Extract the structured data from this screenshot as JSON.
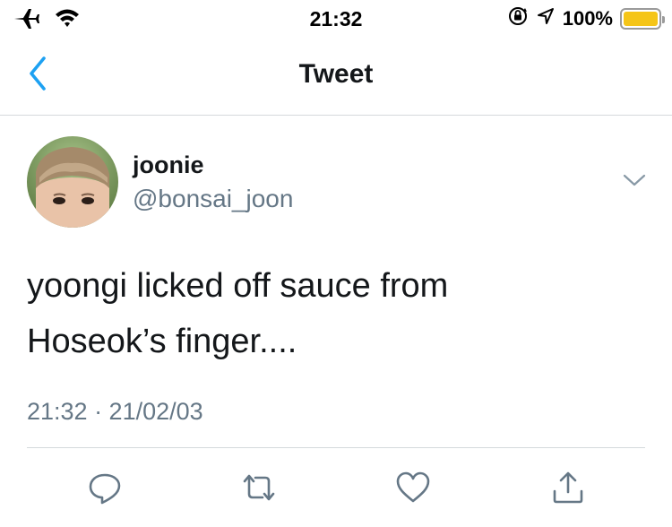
{
  "status_bar": {
    "time": "21:32",
    "battery_percent": "100%",
    "battery_level": 1.0,
    "icons": [
      "airplane-icon",
      "wifi-icon",
      "orientation-lock-icon",
      "location-arrow-icon",
      "battery-icon"
    ],
    "battery_color": "#f5c518"
  },
  "nav": {
    "title": "Tweet",
    "back_icon": "chevron-left-icon",
    "accent_color": "#1da1f2"
  },
  "tweet": {
    "author_name": "joonie",
    "author_handle": "@bonsai_joon",
    "text_lines": [
      "yoongi licked off sauce from",
      "Hoseok’s finger...."
    ],
    "timestamp": "21:32 · 21/02/03",
    "menu_icon": "chevron-down-icon"
  },
  "actions": [
    {
      "icon": "reply-icon"
    },
    {
      "icon": "retweet-icon"
    },
    {
      "icon": "like-icon"
    },
    {
      "icon": "share-icon"
    }
  ],
  "colors": {
    "text": "#14171a",
    "secondary_text": "#657786",
    "divider": "#d5d9dc",
    "icon_gray": "#657786"
  }
}
